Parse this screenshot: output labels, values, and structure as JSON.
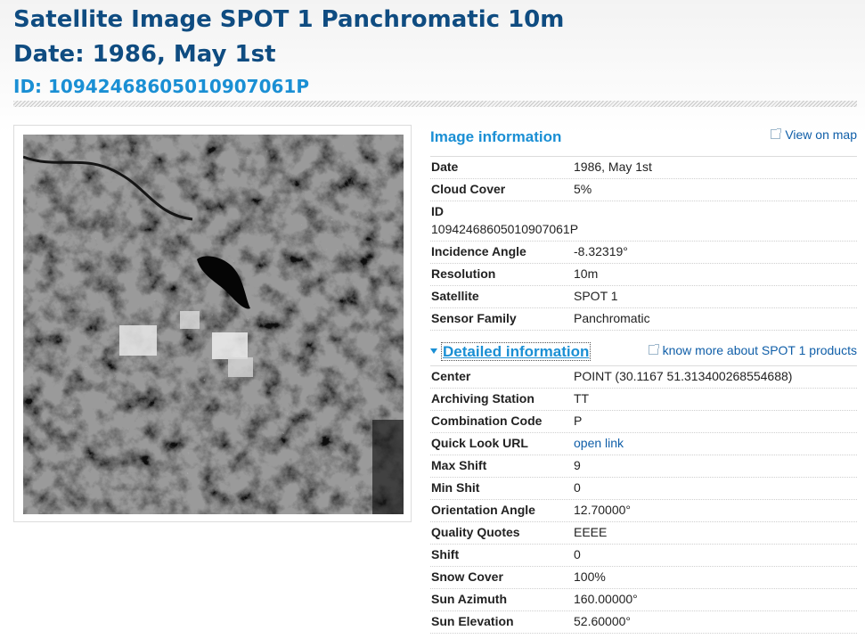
{
  "header": {
    "title": "Satellite Image SPOT 1 Panchromatic 10m",
    "date_line": "Date: 1986, May 1st",
    "id_line": "ID: 10942468605010907061P"
  },
  "image_info": {
    "section_title": "Image information",
    "view_on_map": "View on map",
    "rows": [
      {
        "label": "Date",
        "value": "1986, May 1st"
      },
      {
        "label": "Cloud Cover",
        "value": "5%"
      },
      {
        "label": "ID",
        "value": "10942468605010907061P"
      },
      {
        "label": "Incidence Angle",
        "value": "-8.32319°"
      },
      {
        "label": "Resolution",
        "value": "10m"
      },
      {
        "label": "Satellite",
        "value": "SPOT 1"
      },
      {
        "label": "Sensor Family",
        "value": "Panchromatic"
      }
    ]
  },
  "detailed_info": {
    "section_title": "Detailed information",
    "know_more": "know more about SPOT 1 products",
    "rows": [
      {
        "label": "Center",
        "value": "POINT (30.1167 51.313400268554688)"
      },
      {
        "label": "Archiving Station",
        "value": "TT"
      },
      {
        "label": "Combination Code",
        "value": "P"
      },
      {
        "label": "Quick Look URL",
        "value": "open link"
      },
      {
        "label": "Max Shift",
        "value": "9"
      },
      {
        "label": "Min Shit",
        "value": "0"
      },
      {
        "label": "Orientation Angle",
        "value": "12.70000°"
      },
      {
        "label": "Quality Quotes",
        "value": "EEEE"
      },
      {
        "label": "Shift",
        "value": "0"
      },
      {
        "label": "Snow Cover",
        "value": "100%"
      },
      {
        "label": "Sun Azimuth",
        "value": "160.00000°"
      },
      {
        "label": "Sun Elevation",
        "value": "52.60000°"
      }
    ]
  },
  "icons": {
    "external_link": "external-link-icon",
    "expand": "triangle-down-icon"
  },
  "colors": {
    "title": "#0f4c81",
    "accent": "#1a8fd4",
    "link": "#0f5ea8"
  }
}
